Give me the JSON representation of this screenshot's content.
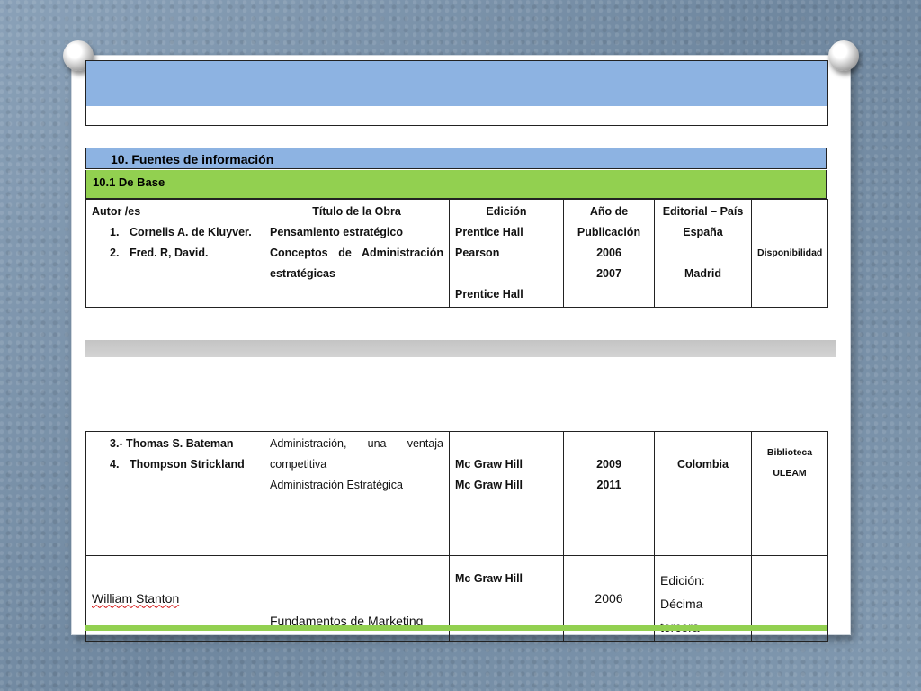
{
  "section_header": "10. Fuentes de información",
  "subsection_header": "10.1  De Base",
  "table1": {
    "headers": {
      "author": "Autor /es",
      "title": "Título de la Obra",
      "edition": "Edición",
      "year_line1": "Año de",
      "year_line2": "Publicación",
      "publisher_country": "Editorial – País"
    },
    "authors": [
      "1.",
      "Cornelis A. de Kluyver.",
      "2.",
      "Fred. R, David."
    ],
    "titles": [
      "Pensamiento estratégico",
      "Conceptos de Administración",
      "estratégicas"
    ],
    "editions": [
      "Prentice Hall Pearson",
      "Prentice Hall"
    ],
    "years": [
      "2006",
      "2007"
    ],
    "countries": [
      "España",
      "Madrid"
    ],
    "availability": "Disponibilidad"
  },
  "table2": {
    "row1": {
      "authors": [
        "3.- Thomas S. Bateman",
        "4.",
        "Thompson Strickland"
      ],
      "titles": [
        "Administración, una ventaja",
        "competitiva",
        "Administración Estratégica"
      ],
      "editions": [
        "Mc Graw Hill",
        "Mc Graw Hill"
      ],
      "years": [
        "2009",
        "2011"
      ],
      "country": "Colombia",
      "availability": "Biblioteca ULEAM"
    },
    "row2": {
      "author": "William Stanton",
      "title": "Fundamentos  de Marketing",
      "edition": "Mc Graw Hill",
      "year": "2006",
      "edition_note_line1": "Edición: Décima",
      "edition_note_line2": "tercera"
    }
  }
}
